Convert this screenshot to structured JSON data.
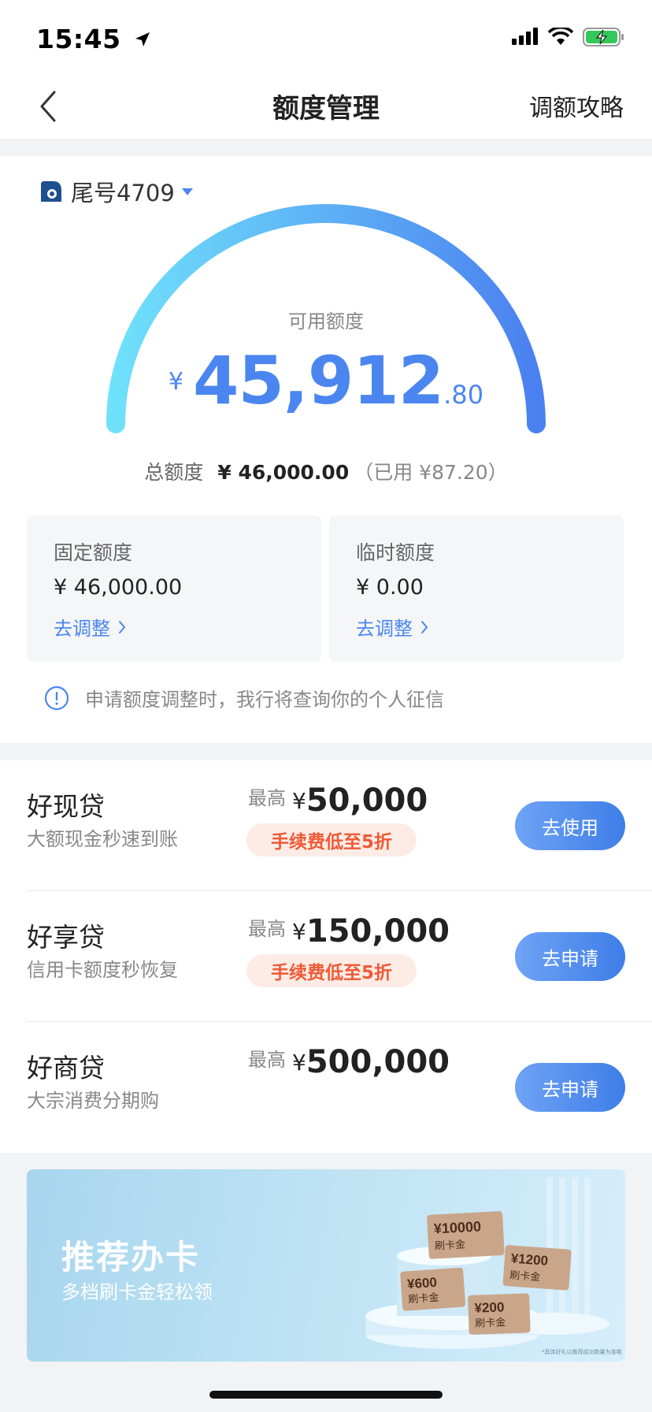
{
  "status_bar": {
    "time": "15:45"
  },
  "nav": {
    "title": "额度管理",
    "right_link": "调额攻略"
  },
  "card": {
    "selector_label": "尾号4709",
    "available_label": "可用额度",
    "currency_symbol": "¥",
    "available_int": "45,912",
    "available_dec": ".80",
    "total_label": "总额度",
    "total_value": "¥ 46,000.00",
    "total_used": "（已用 ¥87.20）",
    "gauge_fill": 1.0
  },
  "limits": {
    "fixed": {
      "title": "固定额度",
      "value": "¥ 46,000.00",
      "link": "去调整"
    },
    "temporary": {
      "title": "临时额度",
      "value": "¥ 0.00",
      "link": "去调整"
    }
  },
  "notice": {
    "text": "申请额度调整时，我行将查询你的个人征信"
  },
  "loans": [
    {
      "name": "好现贷",
      "desc": "大额现金秒速到账",
      "max_label": "最高",
      "symbol": "¥",
      "max_value": "50,000",
      "tag": "手续费低至5折",
      "button": "去使用"
    },
    {
      "name": "好享贷",
      "desc": "信用卡额度秒恢复",
      "max_label": "最高",
      "symbol": "¥",
      "max_value": "150,000",
      "tag": "手续费低至5折",
      "button": "去申请"
    },
    {
      "name": "好商贷",
      "desc": "大宗消费分期购",
      "max_label": "最高",
      "symbol": "¥",
      "max_value": "500,000",
      "tag": "",
      "button": "去申请"
    }
  ],
  "banner": {
    "title": "推荐办卡",
    "subtitle": "多档刷卡金轻松领",
    "vouchers": [
      {
        "amount": "¥10000",
        "label": "刷卡金"
      },
      {
        "amount": "¥1200",
        "label": "刷卡金"
      },
      {
        "amount": "¥600",
        "label": "刷卡金"
      },
      {
        "amount": "¥200",
        "label": "刷卡金"
      }
    ],
    "footnote": "*具体好礼以推荐成功数量为准哦"
  },
  "colors": {
    "accent": "#4b86f0",
    "tag_text": "#ee5a36",
    "tag_bg": "#fdece6"
  }
}
